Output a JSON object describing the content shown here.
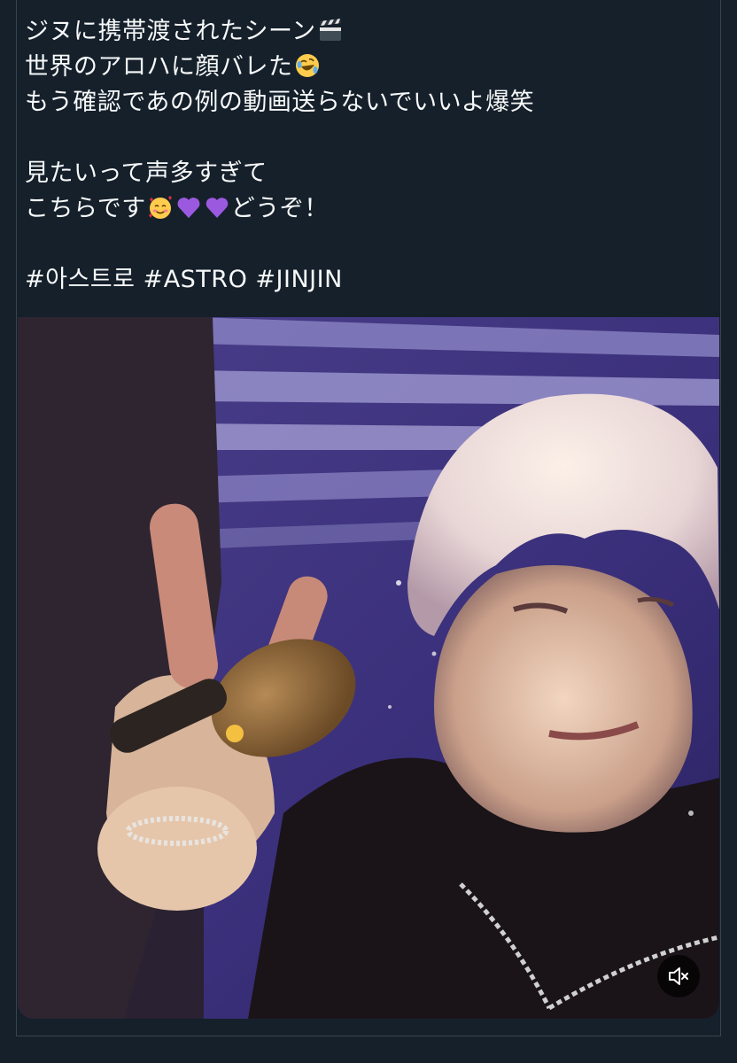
{
  "tweet": {
    "lines": [
      "ジヌに携帯渡されたシーン",
      "世界のアロハに顔バレた",
      "もう確認であの例の動画送らないでいいよ爆笑",
      "見たいって声多すぎて",
      "こちらです",
      "どうぞ！"
    ],
    "hashtags": [
      "#아스트로",
      "#ASTRO",
      "#JINJIN"
    ],
    "emojis": {
      "line1": "clapper-board",
      "line2": "rolling-on-floor-laughing",
      "line5": [
        "smiling-face-with-hearts",
        "purple-heart",
        "purple-heart"
      ]
    }
  },
  "media": {
    "type": "video",
    "mute_icon": "speaker-muted-icon"
  },
  "colors": {
    "background": "#15202b",
    "border": "#38444d",
    "text": "#f7f9f9"
  }
}
